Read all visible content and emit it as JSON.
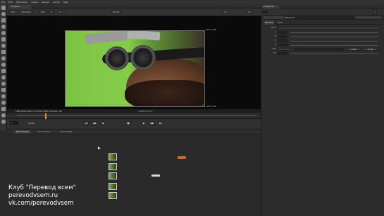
{
  "menubar": {
    "items": [
      "File",
      "Edit",
      "Workspace",
      "Viewer",
      "Render",
      "Cache",
      "Help"
    ]
  },
  "viewer": {
    "tab_label": "Viewer1",
    "controls": [
      "rgba",
      "rgba.alpha",
      "RGB",
      "A",
      "A",
      "Default",
      "1:1",
      "2D"
    ],
    "frame_label_top": "1920,1080",
    "frame_label_bottom": "1920,1080",
    "info_left": "1920x1080  bbox: 0 0 1920 1080  channels: rgb",
    "info_right": "x=4671 y=1 0"
  },
  "transport": {
    "frame": "1",
    "global_label": "Global",
    "buttons": [
      "|◀",
      "◀◀",
      "◀",
      "■",
      "▶",
      "▶▶",
      "▶|"
    ]
  },
  "node_graph": {
    "tabs": [
      "Node Graph",
      "Curve Editor",
      "Dope Sheet"
    ]
  },
  "properties": {
    "tab_label": "Properties",
    "node_name": "Dissolve1",
    "subtabs": [
      "Dissolve",
      "Node"
    ],
    "rows": [
      {
        "label": "which"
      },
      {
        "label": "A"
      },
      {
        "label": "B"
      },
      {
        "label": "C"
      },
      {
        "label": "D"
      },
      {
        "label": "mask",
        "buttons": [
          "invert",
          "fringe"
        ]
      },
      {
        "label": "mix"
      }
    ]
  },
  "watermark": {
    "line1": "Клуб \"Перевод всем\"",
    "line2": "perevodvsem.ru",
    "line3": "vk.com/perevodvsem"
  }
}
